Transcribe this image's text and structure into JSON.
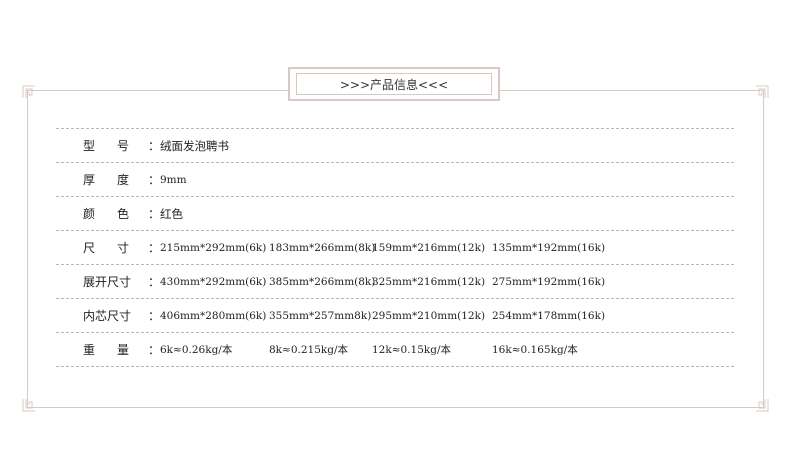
{
  "title": ">>>产品信息<<<",
  "rows": [
    {
      "label_chars": [
        "型",
        "号"
      ],
      "values": [
        "绒面发泡聘书"
      ]
    },
    {
      "label_chars": [
        "厚",
        "度"
      ],
      "values": [
        "9mm"
      ]
    },
    {
      "label_chars": [
        "颜",
        "色"
      ],
      "values": [
        "红色"
      ]
    },
    {
      "label_chars": [
        "尺",
        "寸"
      ],
      "values": [
        "215mm*292mm(6k)",
        "183mm*266mm(8k)",
        "159mm*216mm(12k)",
        "135mm*192mm(16k)"
      ]
    },
    {
      "label": "展开尺寸",
      "values": [
        "430mm*292mm(6k)",
        "385mm*266mm(8k)",
        "325mm*216mm(12k)",
        "275mm*192mm(16k)"
      ]
    },
    {
      "label": "内芯尺寸",
      "values": [
        "406mm*280mm(6k)",
        "355mm*257mm8k)",
        "295mm*210mm(12k)",
        "254mm*178mm(16k)"
      ]
    },
    {
      "label_chars": [
        "重",
        "量"
      ],
      "values": [
        "6k≈0.26kg/本",
        "8k≈0.215kg/本",
        "12k≈0.15kg/本",
        "16k≈0.165kg/本"
      ]
    }
  ],
  "colon": "："
}
